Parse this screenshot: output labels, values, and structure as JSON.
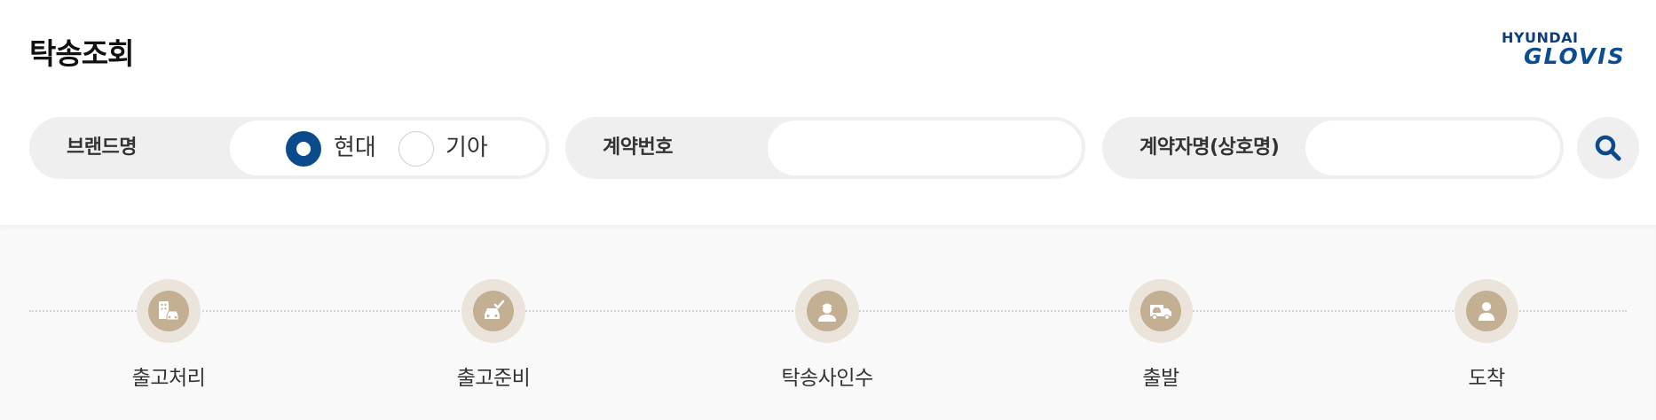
{
  "header": {
    "title": "탁송조회",
    "logo_top": "HYUNDAI",
    "logo_bottom": "GLOVIS"
  },
  "filters": {
    "brand": {
      "label": "브랜드명",
      "options": [
        "현대",
        "기아"
      ],
      "selected": "현대"
    },
    "contract_no": {
      "label": "계약번호",
      "value": ""
    },
    "contractor": {
      "label": "계약자명(상호명)",
      "value": ""
    },
    "search_icon": "search-icon"
  },
  "steps": [
    {
      "label": "출고처리",
      "icon": "building-car-icon"
    },
    {
      "label": "출고준비",
      "icon": "car-check-icon"
    },
    {
      "label": "탁송사인수",
      "icon": "driver-icon"
    },
    {
      "label": "출발",
      "icon": "truck-icon"
    },
    {
      "label": "도착",
      "icon": "person-icon"
    }
  ],
  "colors": {
    "brand_blue": "#0b4a8b",
    "step_core": "#c3b093",
    "step_ring": "#ebe4da"
  }
}
